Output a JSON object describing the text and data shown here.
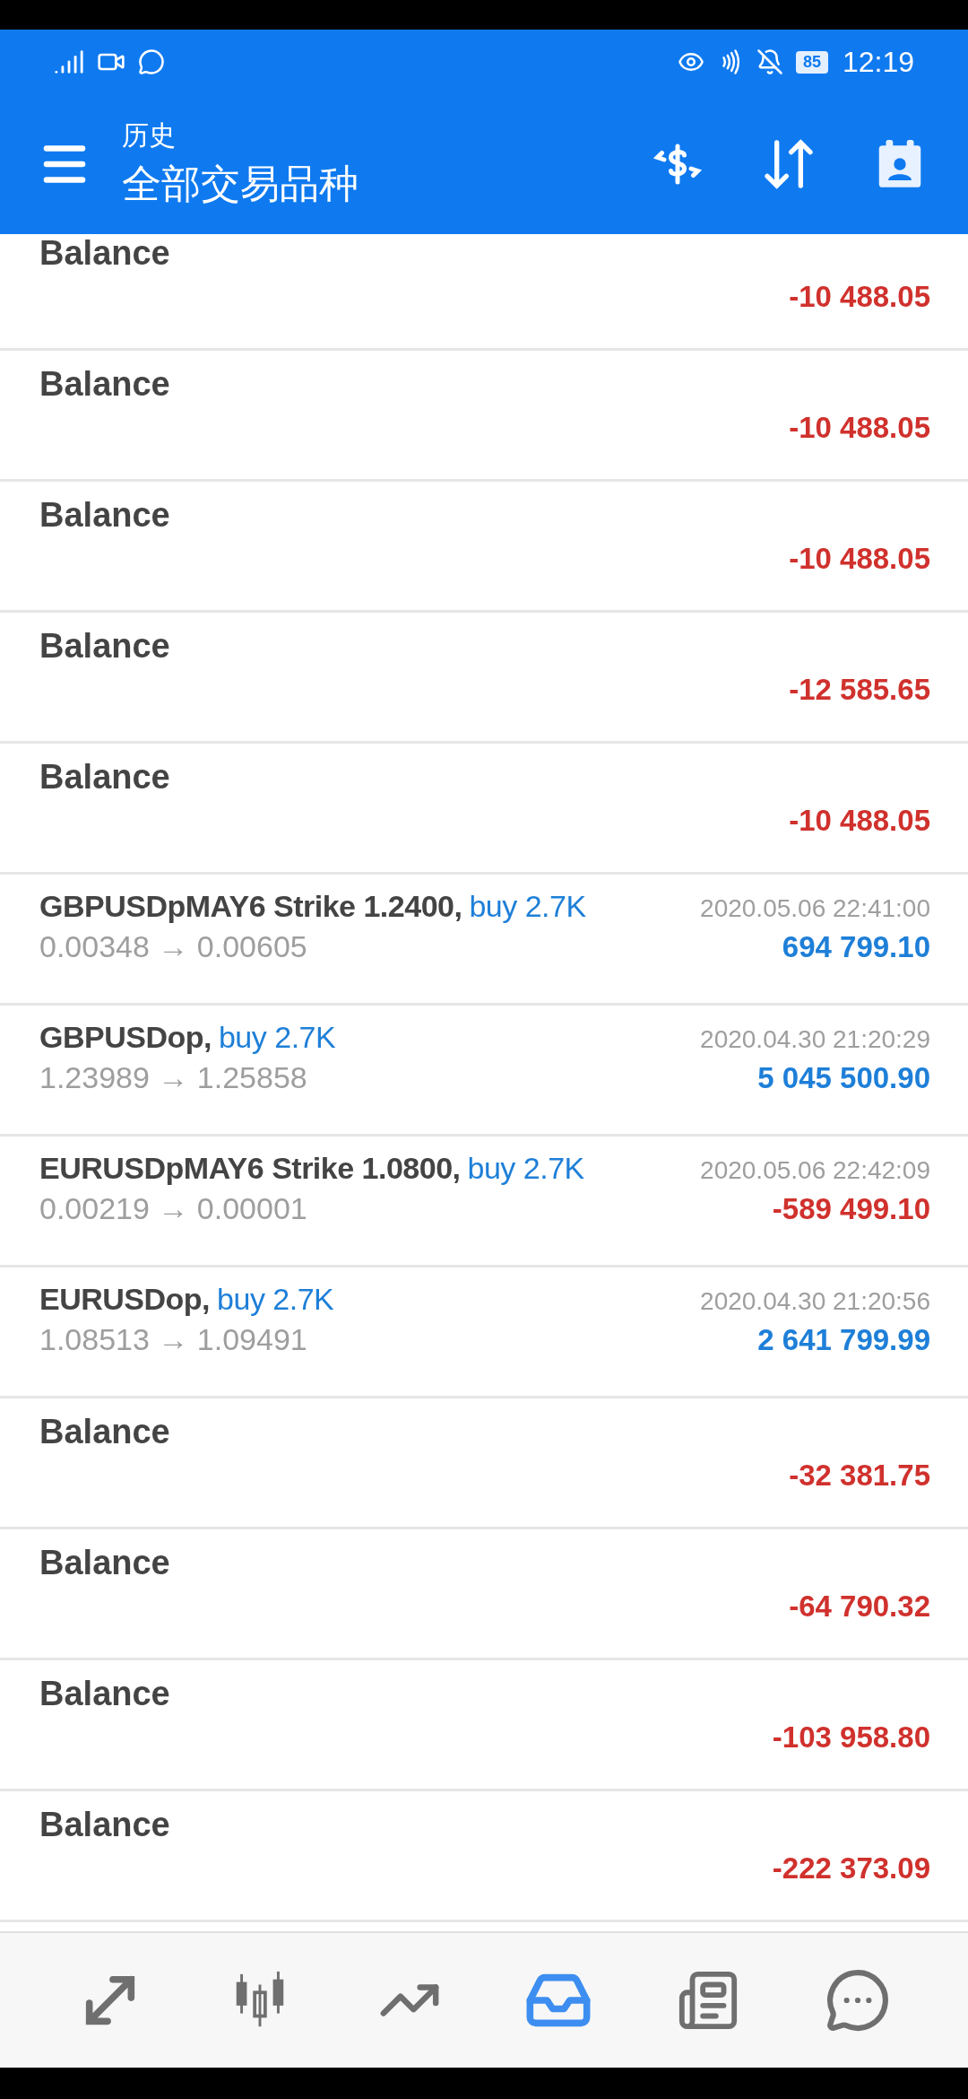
{
  "status_bar": {
    "battery": "85",
    "time": "12:19"
  },
  "header": {
    "subtitle": "历史",
    "title": "全部交易品种"
  },
  "rows": [
    {
      "kind": "balance",
      "label": "Balance",
      "amount": "-10 488.05",
      "color": "#d0312d"
    },
    {
      "kind": "balance",
      "label": "Balance",
      "amount": "-10 488.05",
      "color": "#d0312d"
    },
    {
      "kind": "balance",
      "label": "Balance",
      "amount": "-10 488.05",
      "color": "#d0312d"
    },
    {
      "kind": "balance",
      "label": "Balance",
      "amount": "-12 585.65",
      "color": "#d0312d"
    },
    {
      "kind": "balance",
      "label": "Balance",
      "amount": "-10 488.05",
      "color": "#d0312d"
    },
    {
      "kind": "trade",
      "symbol": "GBPUSDpMAY6 Strike 1.2400,",
      "side": "buy 2.7K",
      "time": "2020.05.06 22:41:00",
      "prices": "0.00348 → 0.00605",
      "amount": "694 799.10",
      "color": "#1e7fd8"
    },
    {
      "kind": "trade",
      "symbol": "GBPUSDop,",
      "side": "buy 2.7K",
      "time": "2020.04.30 21:20:29",
      "prices": "1.23989 → 1.25858",
      "amount": "5 045 500.90",
      "color": "#1e7fd8"
    },
    {
      "kind": "trade",
      "symbol": "EURUSDpMAY6 Strike 1.0800,",
      "side": "buy 2.7K",
      "time": "2020.05.06 22:42:09",
      "prices": "0.00219 → 0.00001",
      "amount": "-589 499.10",
      "color": "#d0312d"
    },
    {
      "kind": "trade",
      "symbol": "EURUSDop,",
      "side": "buy 2.7K",
      "time": "2020.04.30 21:20:56",
      "prices": "1.08513 → 1.09491",
      "amount": "2 641 799.99",
      "color": "#1e7fd8"
    },
    {
      "kind": "balance",
      "label": "Balance",
      "amount": "-32 381.75",
      "color": "#d0312d"
    },
    {
      "kind": "balance",
      "label": "Balance",
      "amount": "-64 790.32",
      "color": "#d0312d"
    },
    {
      "kind": "balance",
      "label": "Balance",
      "amount": "-103 958.80",
      "color": "#d0312d"
    },
    {
      "kind": "balance",
      "label": "Balance",
      "amount": "-222 373.09",
      "color": "#d0312d"
    }
  ],
  "bottom_nav": [
    {
      "selected": false
    },
    {
      "selected": false
    },
    {
      "selected": false
    },
    {
      "selected": true
    },
    {
      "selected": false
    },
    {
      "selected": false
    }
  ]
}
